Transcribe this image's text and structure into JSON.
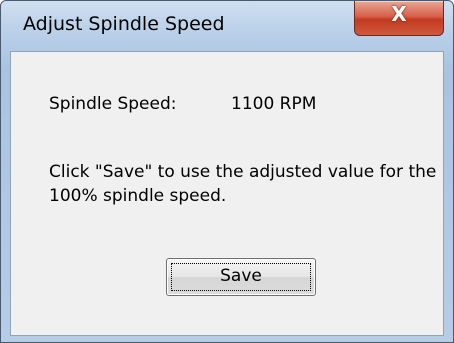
{
  "window": {
    "title": "Adjust Spindle Speed",
    "close_glyph": "X",
    "close_icon": "close-icon",
    "accent_colors": {
      "close_button": "#c8452a",
      "frame": "#a9c3e0",
      "client": "#f0f0f0"
    }
  },
  "content": {
    "speed_label": "Spindle Speed:",
    "speed_value": "1100 RPM",
    "message": "Click \"Save\" to use the adjusted value for the 100% spindle speed."
  },
  "buttons": {
    "save_label": "Save"
  }
}
